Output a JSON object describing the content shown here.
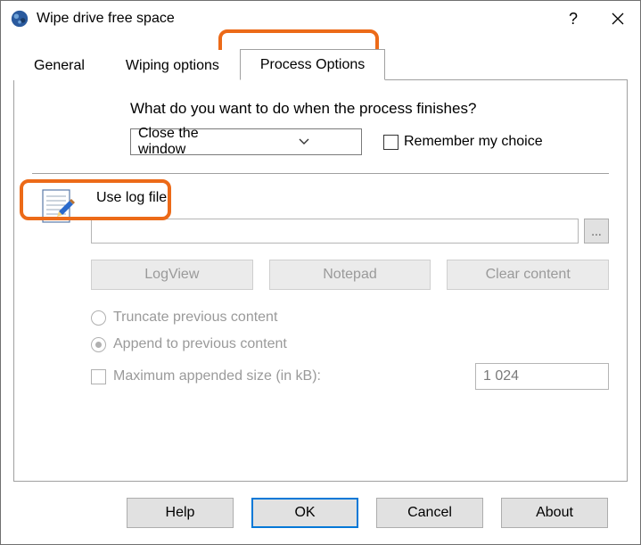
{
  "window": {
    "title": "Wipe drive free space"
  },
  "tabs": [
    {
      "label": "General"
    },
    {
      "label": "Wiping options"
    },
    {
      "label": "Process Options"
    }
  ],
  "process": {
    "prompt": "What do you want to do when the process finishes?",
    "finish_action": "Close the window",
    "remember_label": "Remember my choice"
  },
  "log": {
    "use_log_label": "Use log file",
    "path": "",
    "browse_label": "...",
    "buttons": {
      "logview": "LogView",
      "notepad": "Notepad",
      "clear": "Clear content"
    },
    "truncate_label": "Truncate previous content",
    "append_label": "Append to previous content",
    "max_size_label": "Maximum appended size (in kB):",
    "max_size_value": "1 024"
  },
  "footer": {
    "help": "Help",
    "ok": "OK",
    "cancel": "Cancel",
    "about": "About"
  }
}
